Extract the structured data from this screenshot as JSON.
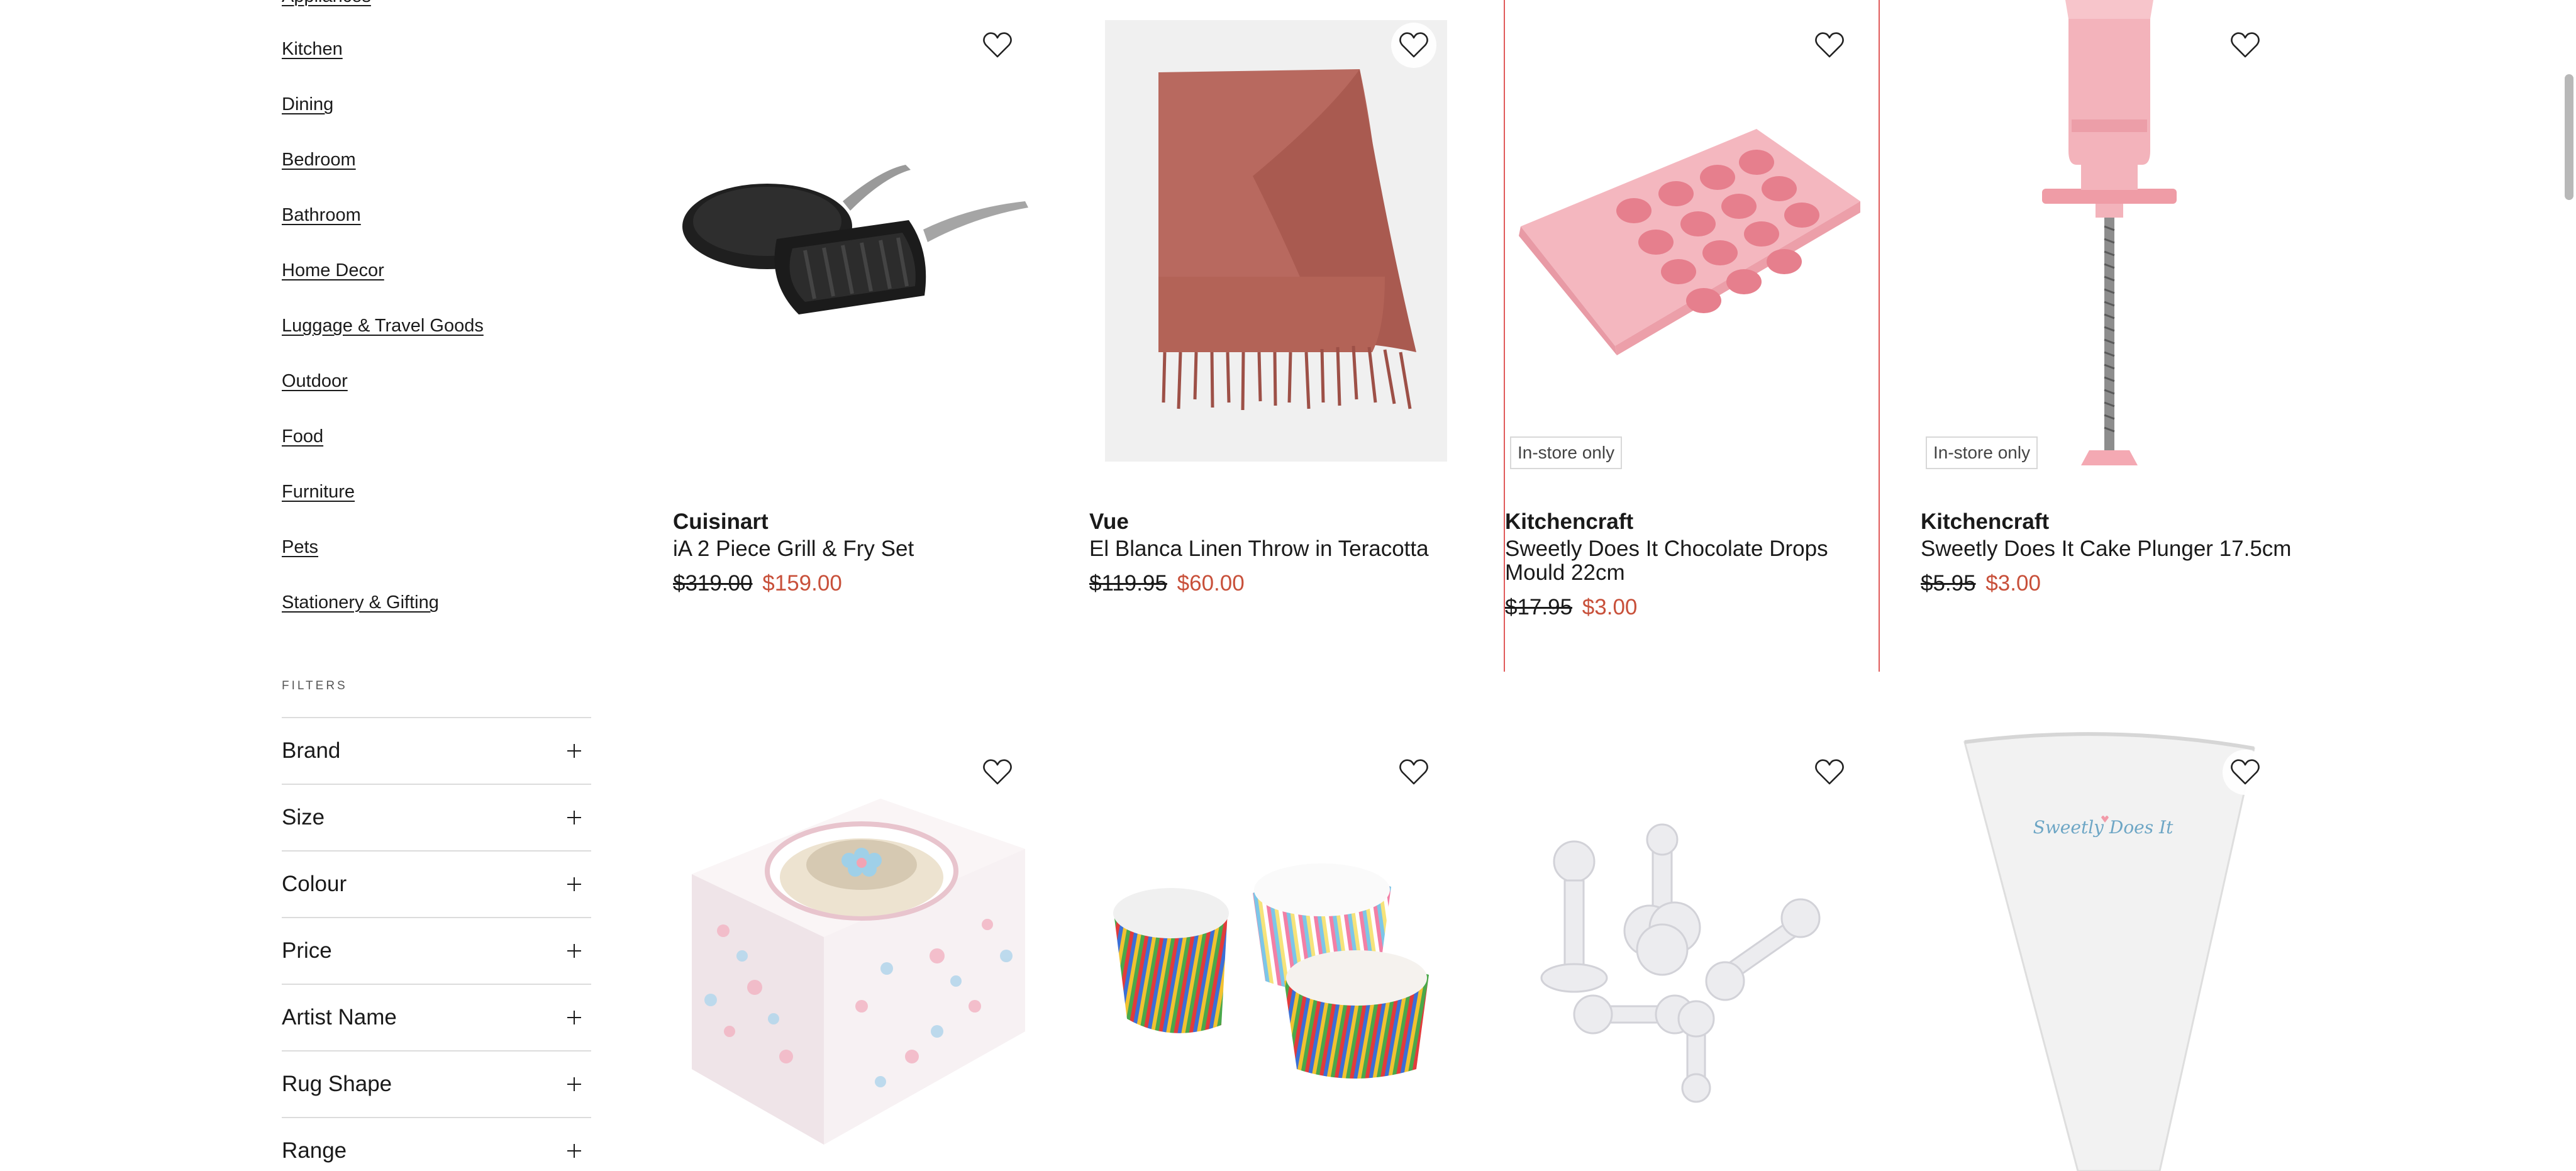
{
  "sidebar": {
    "partial_top_link": "Appliances",
    "categories": [
      "Kitchen",
      "Dining",
      "Bedroom",
      "Bathroom",
      "Home Decor",
      "Luggage & Travel Goods",
      "Outdoor",
      "Food",
      "Furniture",
      "Pets",
      "Stationery & Gifting"
    ],
    "filters_heading": "FILTERS",
    "filters": [
      "Brand",
      "Size",
      "Colour",
      "Price",
      "Artist Name",
      "Rug Shape",
      "Range"
    ]
  },
  "products": [
    {
      "brand": "Cuisinart",
      "name": "iA 2 Piece Grill & Fry Set",
      "old_price": "$319.00",
      "new_price": "$159.00",
      "badge": ""
    },
    {
      "brand": "Vue",
      "name": "El Blanca Linen Throw in Teracotta",
      "old_price": "$119.95",
      "new_price": "$60.00",
      "badge": ""
    },
    {
      "brand": "Kitchencraft",
      "name": "Sweetly Does It Chocolate Drops Mould 22cm",
      "old_price": "$17.95",
      "new_price": "$3.00",
      "badge": "In-store only"
    },
    {
      "brand": "Kitchencraft",
      "name": "Sweetly Does It Cake Plunger 17.5cm",
      "old_price": "$5.95",
      "new_price": "$3.00",
      "badge": "In-store only"
    }
  ],
  "piping_bag_logo": "Sweetly Does It",
  "colors": {
    "sale_price": "#c8503a",
    "hover_outline": "#e05a5a",
    "divider": "#dcdcdc"
  },
  "icons": [
    "heart-icon",
    "plus-icon"
  ]
}
